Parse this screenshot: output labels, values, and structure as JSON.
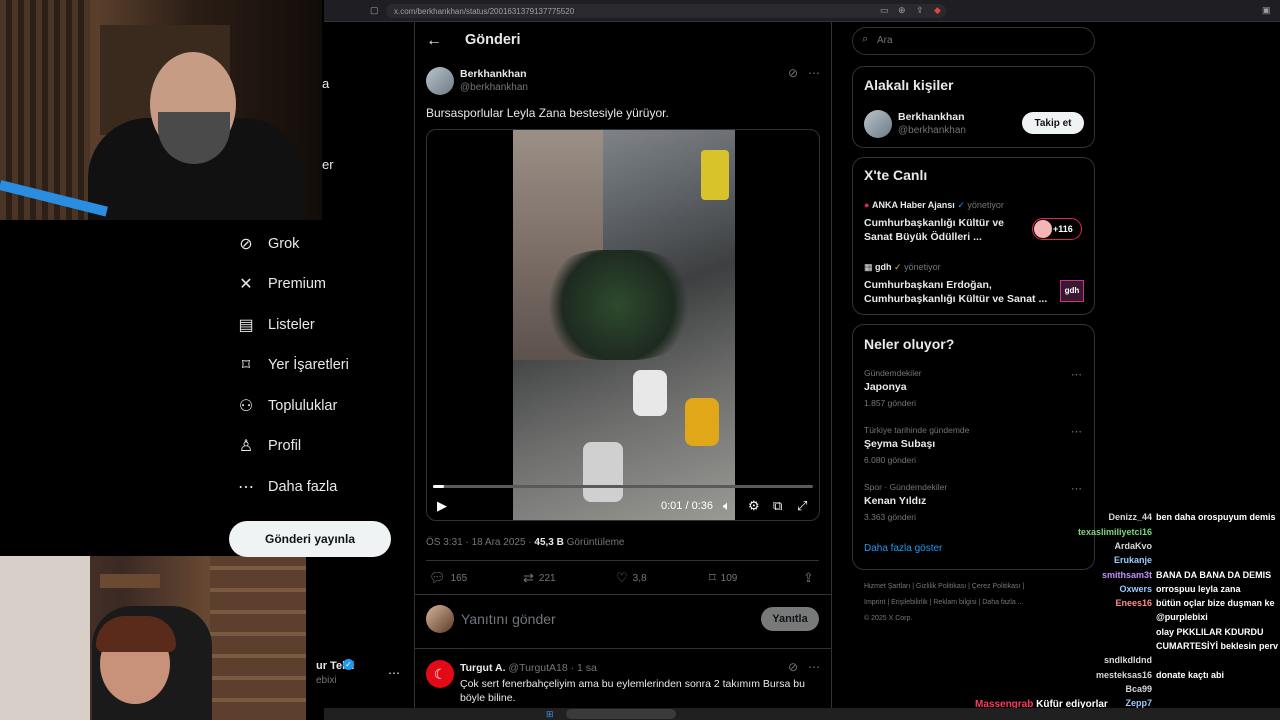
{
  "browser": {
    "url": "x.com/berkhankhan/status/2001631379137775520"
  },
  "left_nav": {
    "items": [
      {
        "icon": "grok-icon",
        "label": "Grok"
      },
      {
        "icon": "x-logo-icon",
        "label": "Premium"
      },
      {
        "icon": "list-icon",
        "label": "Listeler"
      },
      {
        "icon": "bookmark-icon",
        "label": "Yer İşaretleri"
      },
      {
        "icon": "communities-icon",
        "label": "Topluluklar"
      },
      {
        "icon": "profile-icon",
        "label": "Profil"
      },
      {
        "icon": "more-icon",
        "label": "Daha fazla"
      }
    ],
    "post_button": "Gönderi yayınla",
    "account_name": "ur Telci",
    "account_handle": "ebixi",
    "partial_1": "a",
    "partial_2": "er"
  },
  "header": {
    "title": "Gönderi"
  },
  "tweet": {
    "author": "Berkhankhan",
    "handle": "@berkhankhan",
    "text": "Bursasporlular Leyla Zana bestesiyle yürüyor.",
    "video_time": "0:01 / 0:36",
    "video_progress": 0.03,
    "timestamp": "ÖS 3:31 · 18 Ara 2025 · ",
    "views": "45,3 B",
    "views_label": " Görüntüleme",
    "replies": "165",
    "retweets": "221",
    "likes": "3,8",
    "bookmarks": "109"
  },
  "reply_box": {
    "placeholder": "Yanıtını gönder",
    "button": "Yanıtla"
  },
  "reply": {
    "author": "Turgut A.",
    "handle": "@TurgutA18 · 1 sa",
    "text": "Çok sert fenerbahçeliyim ama bu eylemlerinden sonra 2 takımım Bursa bu böyle biline."
  },
  "right": {
    "search_placeholder": "Ara",
    "related": {
      "title": "Alakalı kişiler",
      "name": "Berkhankhan",
      "handle": "@berkhankhan",
      "follow": "Takip et"
    },
    "live": {
      "title": "X'te Canlı",
      "items": [
        {
          "source": "ANKA Haber Ajansı",
          "role": "yönetiyor",
          "title": "Cumhurbaşkanlığı Kültür ve Sanat Büyük Ödülleri ...",
          "badge": "+116"
        },
        {
          "source": "gdh",
          "role": "yönetiyor",
          "title": "Cumhurbaşkanı Erdoğan, Cumhurbaşkanlığı Kültür ve Sanat ...",
          "badge": "gdh"
        }
      ]
    },
    "trends": {
      "title": "Neler oluyor?",
      "items": [
        {
          "category": "Gündemdekiler",
          "name": "Japonya",
          "count": "1.857 gönderi"
        },
        {
          "category": "Türkiye tarihinde gündemde",
          "name": "Şeyma Subaşı",
          "count": "6.080 gönderi"
        },
        {
          "category": "Spor · Gündemdekiler",
          "name": "Kenan Yıldız",
          "count": "3.363 gönderi"
        }
      ],
      "show_more": "Daha fazla göster"
    },
    "footer": {
      "line1": "Hizmet Şartları  |  Gizlilik Politikası  |  Çerez Politikası  |",
      "line2": "Imprint  |  Erişilebilirlik  |  Reklam bilgisi  |  Daha fazla ...",
      "line3": "© 2025 X Corp."
    }
  },
  "chat": [
    {
      "user": "",
      "msg": "",
      "color": "#8ad"
    },
    {
      "user": "Denizz_44",
      "msg": "ben daha orospuyum demis",
      "color": "#d8d8d8"
    },
    {
      "user": "texaslimiliyetci16",
      "msg": "",
      "color": "#7fd67f"
    },
    {
      "user": "ArdaKvo",
      "msg": "",
      "color": "#d8d8d8"
    },
    {
      "user": "Erukanje",
      "msg": "",
      "color": "#9acbff"
    },
    {
      "user": "smithsam3t",
      "msg": "BANA DA BANA DA DEMIS",
      "color": "#c68cff"
    },
    {
      "user": "Oxwers",
      "msg": "orrospuu leyla zana",
      "color": "#9acbff"
    },
    {
      "user": "Enees16",
      "msg": "bütün oçlar bize duşman ke",
      "color": "#ff8c8c"
    },
    {
      "user": "",
      "msg": "@purplebixi",
      "color": "#d8d8d8"
    },
    {
      "user": "",
      "msg": "olay PKKLILAR KDURDU",
      "color": "#ff6b6b"
    },
    {
      "user": "",
      "msg": "CUMARTESİYİ beklesin perv",
      "color": "#ff6b6b"
    },
    {
      "user": "sndlkdldnd",
      "msg": "",
      "color": "#d8d8d8"
    },
    {
      "user": "mesteksas16",
      "msg": "donate kaçtı abi",
      "color": "#d8d8d8"
    },
    {
      "user": "Bca99",
      "msg": "",
      "color": "#d8d8d8"
    },
    {
      "user": "Zepp7",
      "msg": "",
      "color": "#9acbff"
    }
  ],
  "alert": {
    "user": "Massengrab",
    "msg": "Küfür ediyorlar"
  }
}
